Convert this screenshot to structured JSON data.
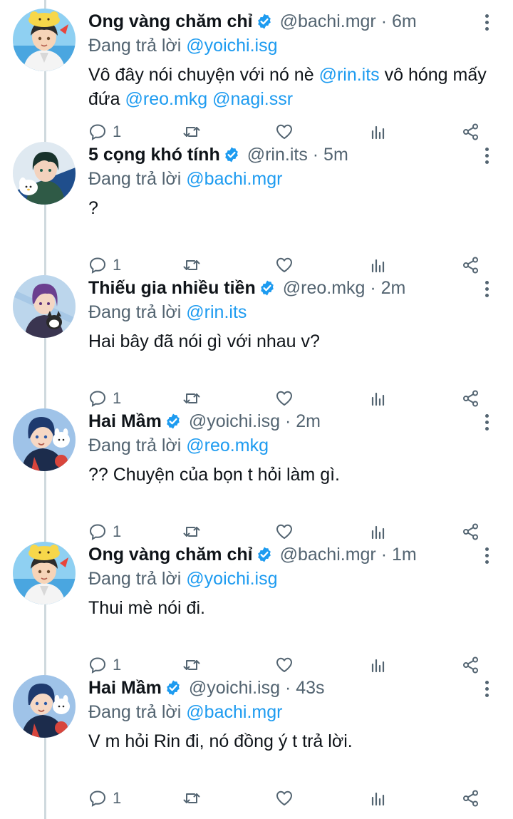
{
  "tweets": [
    {
      "display_name": "Ong vàng chăm chỉ",
      "meta": "@bachi.mgr · 6m",
      "reply_prefix": "Đang trả lời",
      "reply_to": "@yoichi.isg",
      "avatar": "avatar-yellow-hat",
      "body": [
        {
          "t": "Vô đây nói chuyện với nó nè ",
          "link": false
        },
        {
          "t": "@rin.its",
          "link": true
        },
        {
          "t": " vô hóng mấy đứa ",
          "link": false
        },
        {
          "t": "@reo.mkg",
          "link": true
        },
        {
          "t": " ",
          "link": false
        },
        {
          "t": "@nagi.ssr",
          "link": true
        }
      ],
      "reply_count": "1"
    },
    {
      "display_name": "5 cọng khó tính",
      "meta": "@rin.its · 5m",
      "reply_prefix": "Đang trả lời",
      "reply_to": "@bachi.mgr",
      "avatar": "avatar-dark-green",
      "body": [
        {
          "t": "?",
          "link": false
        }
      ],
      "reply_count": "1"
    },
    {
      "display_name": "Thiếu gia nhiều tiền",
      "meta": "@reo.mkg · 2m",
      "reply_prefix": "Đang trả lời",
      "reply_to": "@rin.its",
      "avatar": "avatar-purple-hair",
      "body": [
        {
          "t": "Hai bây đã nói gì với nhau v?",
          "link": false
        }
      ],
      "reply_count": "1"
    },
    {
      "display_name": "Hai Mầm",
      "meta": "@yoichi.isg · 2m",
      "reply_prefix": "Đang trả lời",
      "reply_to": "@reo.mkg",
      "avatar": "avatar-blue-hair",
      "body": [
        {
          "t": "?? Chuyện của bọn t hỏi làm gì.",
          "link": false
        }
      ],
      "reply_count": "1"
    },
    {
      "display_name": "Ong vàng chăm chỉ",
      "meta": "@bachi.mgr · 1m",
      "reply_prefix": "Đang trả lời",
      "reply_to": "@yoichi.isg",
      "avatar": "avatar-yellow-hat",
      "body": [
        {
          "t": "Thui mè nói đi.",
          "link": false
        }
      ],
      "reply_count": "1"
    },
    {
      "display_name": "Hai Mầm",
      "meta": "@yoichi.isg · 43s",
      "reply_prefix": "Đang trả lời",
      "reply_to": "@bachi.mgr",
      "avatar": "avatar-blue-hair",
      "body": [
        {
          "t": "V m hỏi Rin đi, nó đồng ý t trả lời.",
          "link": false
        }
      ],
      "reply_count": "1"
    }
  ],
  "icons": {
    "reply": "reply-icon",
    "retweet": "retweet-icon",
    "like": "like-icon",
    "views": "views-icon",
    "share": "share-icon",
    "more": "more-icon",
    "verified": "verified-badge-icon"
  },
  "colors": {
    "link": "#1d9bf0",
    "muted": "#536471",
    "text": "#0f1419",
    "thread_line": "#cfd9de",
    "verified": "#1d9bf0"
  }
}
